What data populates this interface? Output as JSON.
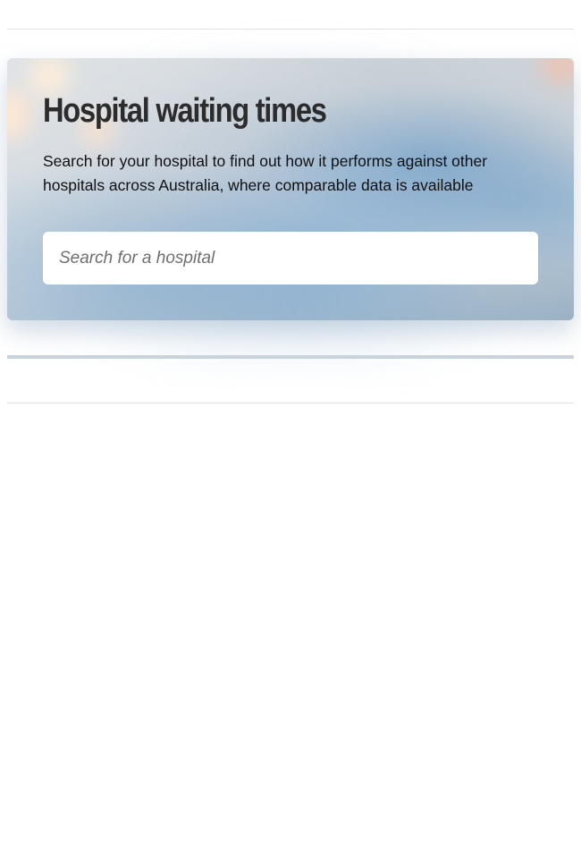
{
  "hero": {
    "title": "Hospital waiting times",
    "description": "Search for your hospital to find out how it performs against other hospitals across Australia, where comparable data is available",
    "background_image": "blurred-operating-theatre-photo"
  },
  "search": {
    "placeholder": "Search for a hospital",
    "value": ""
  },
  "colors": {
    "title_text": "#2c2c2c",
    "body_text": "#111111",
    "divider": "#e2e2e2",
    "accent_blue": "#8fa9bf"
  }
}
